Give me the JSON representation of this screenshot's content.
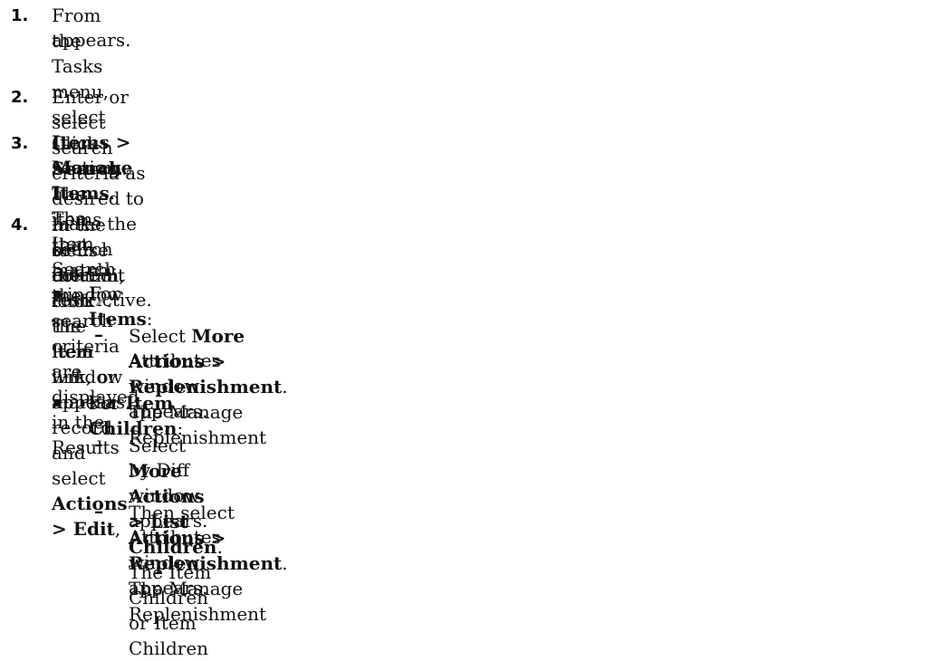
{
  "steps": [
    {
      "number": "1.",
      "parts": [
        "From the Tasks menu, select ",
        "Items > Manage Items",
        ". The Item Search window"
      ],
      "line2": "appears."
    },
    {
      "number": "2.",
      "text": "Enter or select search criteria as desired to make the search more restrictive."
    },
    {
      "number": "3.",
      "parts": [
        "Click ",
        "Search",
        ". The items that match the search criteria are displayed in the Results"
      ],
      "line2": "section."
    },
    {
      "number": "4.",
      "parts": [
        "In the Item column, click the item link, or mark a record and select ",
        "Actions > Edit",
        ","
      ],
      "line2a": "or use the Edit icon",
      "line2b": ". The Item window appears.",
      "icon": "edit-pencil-icon"
    }
  ],
  "sub_items": [
    {
      "prefix": "For ",
      "bold": "Items",
      "suffix": ":",
      "actions": [
        {
          "prefix": "Select ",
          "bold": "More Actions > Replenishment",
          "suffix": ". The Manage Replenishment",
          "line2": "Attributes window appears."
        }
      ]
    },
    {
      "prefix": "For ",
      "bold": "Item Children",
      "suffix": ":",
      "actions": [
        {
          "prefix": "Select ",
          "bold": "More Actions > List Children",
          "suffix": ". The Item Children or Item Children",
          "line2": "by Diff window appears."
        },
        {
          "prefix": "Then select ",
          "bold": "Actions > Replenishment",
          "suffix": ". The Manage Replenishment",
          "line2": "Attributes window appears."
        }
      ]
    }
  ],
  "dash_glyph": "–"
}
